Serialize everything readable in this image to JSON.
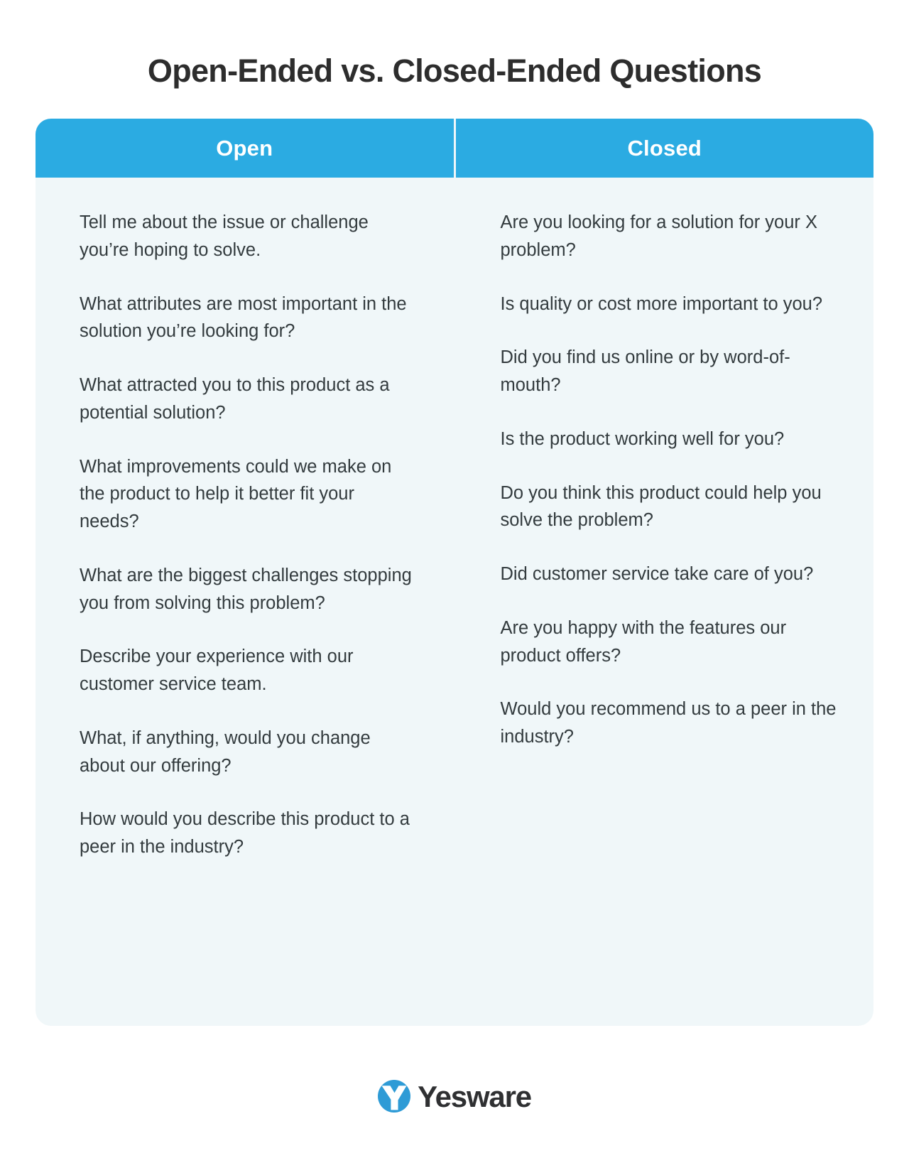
{
  "page": {
    "title": "Open-Ended vs. Closed-Ended Questions",
    "background_color": "#ffffff",
    "title_color": "#2d2d2d"
  },
  "table": {
    "accent_color": "#2babe2",
    "body_background": "#f0f7f9",
    "text_color": "#333b3e",
    "columns": [
      {
        "header": "Open",
        "questions": [
          "Tell me about the issue or challenge you’re hoping to solve.",
          "What attributes are most important in the solution you’re looking for?",
          "What attracted you to this product as a potential solution?",
          "What improvements could we make on the product to help it better fit your needs?",
          "What are the biggest challenges stopping you from solving this problem?",
          "Describe your experience with our customer service team.",
          "What, if anything, would you change about our offering?",
          "How would you describe this product to a peer in the industry?"
        ]
      },
      {
        "header": "Closed",
        "questions": [
          "Are you looking for a solution for your X problem?",
          "Is quality or cost more important to you?",
          "Did you find us online or by word-of-mouth?",
          "Is the product working well for you?",
          "Do you think this product could help you solve the problem?",
          "Did customer service take care of you?",
          "Are you happy with the features our product offers?",
          "Would you recommend us to a peer in the industry?"
        ]
      }
    ]
  },
  "footer": {
    "brand": "Yesware",
    "logo_icon": "yesware-logo-icon",
    "logo_color": "#2e9bd6",
    "wordmark_color": "#2f3032"
  }
}
